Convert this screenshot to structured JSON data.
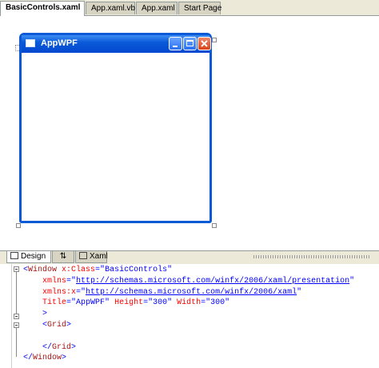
{
  "doc_tabs": [
    {
      "label": "BasicControls.xaml",
      "active": true
    },
    {
      "label": "App.xaml.vb",
      "active": false
    },
    {
      "label": "App.xaml",
      "active": false
    },
    {
      "label": "Start Page",
      "active": false
    }
  ],
  "preview_window": {
    "title": "AppWPF",
    "icon": "window-icon",
    "buttons": [
      "minimize-icon",
      "maximize-icon",
      "close-icon"
    ]
  },
  "view_tabs": [
    {
      "label": "Design",
      "icon": "design-icon",
      "active": true
    },
    {
      "label": "⇅",
      "icon": "swap-panes-icon",
      "active": false
    },
    {
      "label": "Xaml",
      "icon": "xaml-icon",
      "active": false
    }
  ],
  "code": {
    "line1": {
      "lt": "<",
      "tag": "Window",
      "attr": " x:Class",
      "eq": "=\"",
      "val": "BasicControls",
      "q": "\""
    },
    "line2": {
      "attr": "xmlns",
      "eq": "=\"",
      "val": "http://schemas.microsoft.com/winfx/2006/xaml/presentation",
      "q": "\""
    },
    "line3": {
      "attr": "xmlns:x",
      "eq": "=\"",
      "val": "http://schemas.microsoft.com/winfx/2006/xaml",
      "q": "\""
    },
    "line4": {
      "a1": "Title",
      "v1": "\"AppWPF\"",
      "a2": " Height",
      "v2": "\"300\"",
      "a3": " Width",
      "v3": "\"300\""
    },
    "line5": ">",
    "line6": {
      "lt": "<",
      "tag": "Grid",
      "gt": ">"
    },
    "line8": {
      "lt": "</",
      "tag": "Grid",
      "gt": ">"
    },
    "line9": {
      "lt": "</",
      "tag": "Window",
      "gt": ">"
    }
  }
}
